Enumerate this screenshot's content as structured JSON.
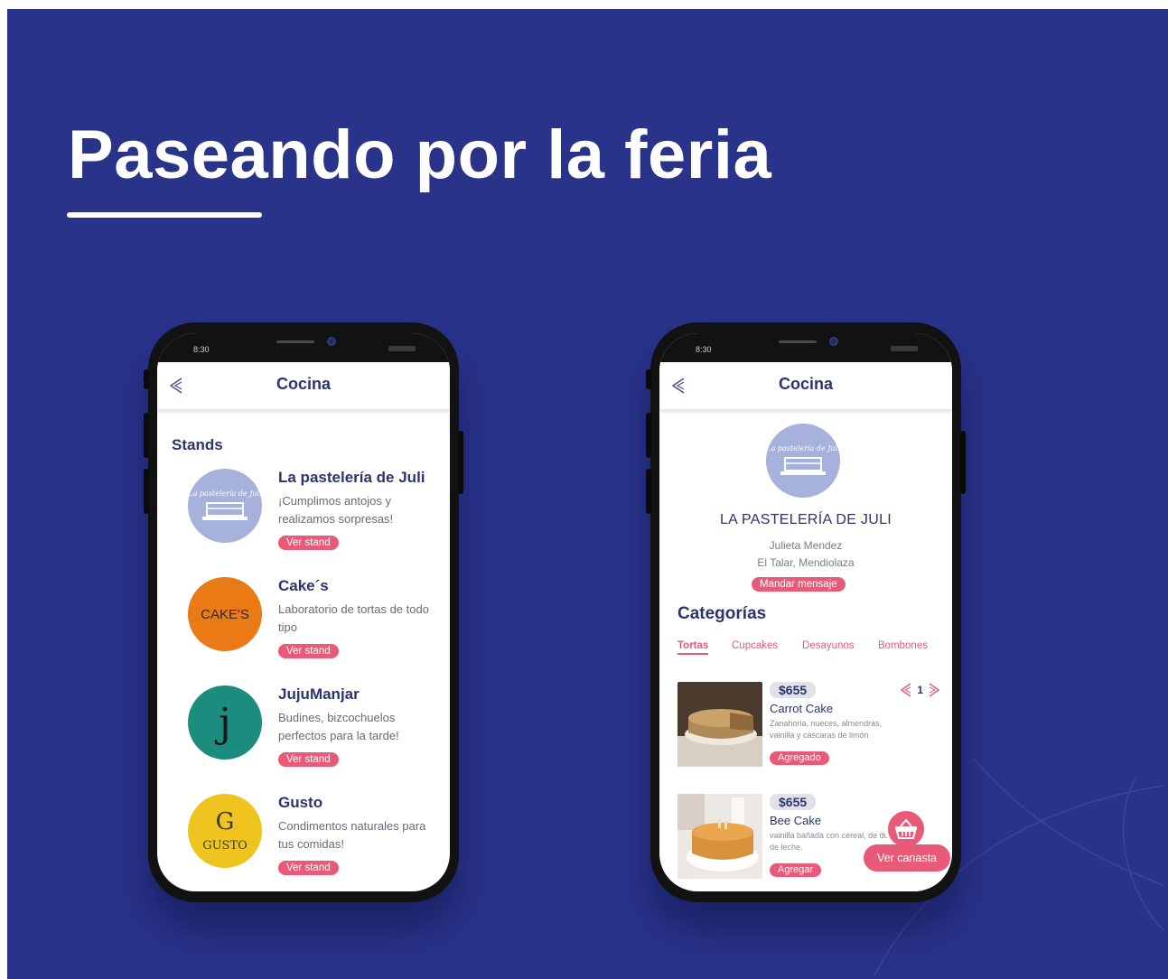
{
  "slide": {
    "title": "Paseando por la feria",
    "background_color": "#29338a",
    "accent_color": "#e85a77"
  },
  "phone_left": {
    "status_time": "8:30",
    "header_title": "Cocina",
    "section_label": "Stands",
    "stands": [
      {
        "name": "La pastelería de Juli",
        "description": "¡Cumplimos antojos y realizamos sorpresas!",
        "button_label": "Ver stand",
        "logo_text": "La pastelería de Juli"
      },
      {
        "name": "Cake´s",
        "description": "Laboratorio de tortas de todo tipo",
        "button_label": "Ver stand",
        "logo_text": "CAKE'S"
      },
      {
        "name": "JujuManjar",
        "description": "Budines, bizcochuelos perfectos para la tarde!",
        "button_label": "Ver stand",
        "logo_text": "j"
      },
      {
        "name": "Gusto",
        "description": "Condimentos naturales para tus comidas!",
        "button_label": "Ver stand",
        "logo_text_top": "G",
        "logo_text_bottom": "GUSTO"
      }
    ]
  },
  "phone_right": {
    "status_time": "8:30",
    "header_title": "Cocina",
    "logo_text": "La pastelería de Juli",
    "stand_title": "LA PASTELERÍA DE JULI",
    "owner": "Julieta Mendez",
    "location": "El Talar, Mendiolaza",
    "message_button": "Mandar mensaje",
    "categories_label": "Categorías",
    "tabs": [
      "Tortas",
      "Cupcakes",
      "Desayunos",
      "Bombones"
    ],
    "active_tab": "Tortas",
    "products": [
      {
        "price": "$655",
        "name": "Carrot Cake",
        "description": "Zanahoria, nueces, almendras, vainilla y cáscaras de limón",
        "button_label": "Agregado",
        "quantity": "1"
      },
      {
        "price": "$655",
        "name": "Bee Cake",
        "description": "vainilla bañada con cereal, de dulce de leche.",
        "button_label": "Agregar"
      }
    ],
    "basket_label": "Ver canasta"
  }
}
